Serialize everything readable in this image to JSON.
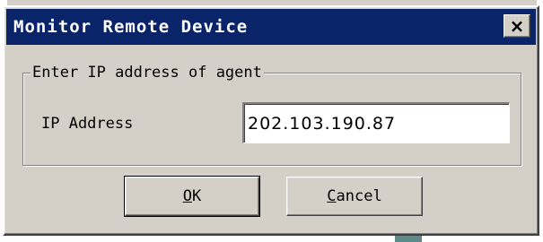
{
  "dialog": {
    "title": "Monitor Remote Device",
    "close_glyph": "×",
    "close_icon": "close-icon"
  },
  "group": {
    "legend": "Enter IP address of agent",
    "ip_label": "IP Address",
    "ip_value": "202.103.190.87"
  },
  "buttons": {
    "ok_mnemonic": "O",
    "ok_rest": "K",
    "cancel_mnemonic": "C",
    "cancel_rest": "ancel"
  },
  "colors": {
    "titlebar": "#0a246a",
    "face": "#d4d0c8"
  }
}
